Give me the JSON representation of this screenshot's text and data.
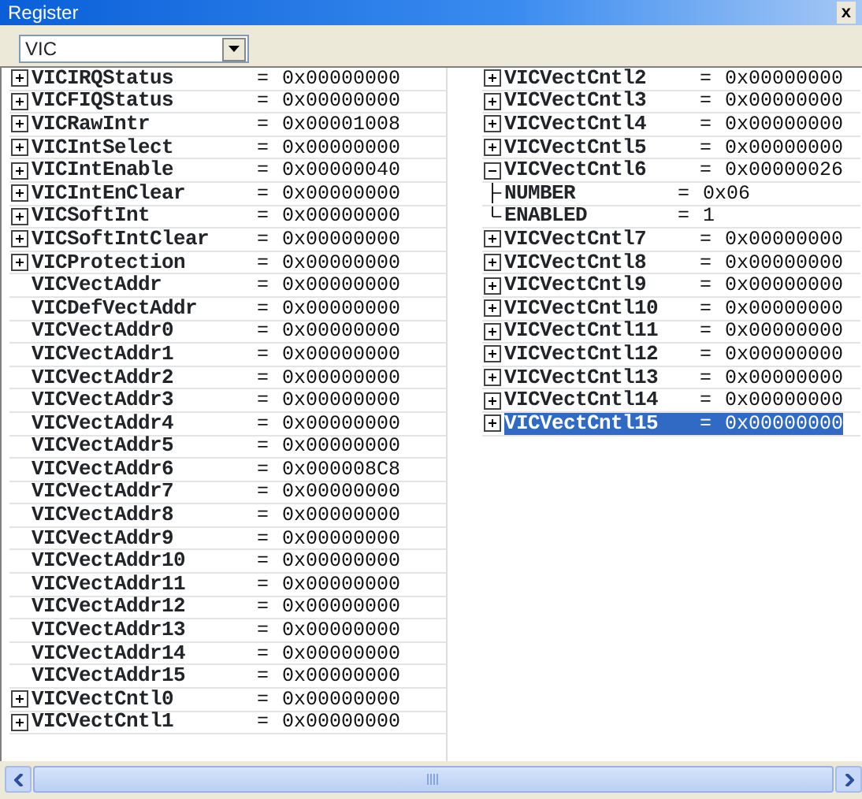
{
  "window": {
    "title": "Register",
    "close": "x"
  },
  "module_select": {
    "value": "VIC"
  },
  "columns": [
    {
      "rows": [
        {
          "name": "VICIRQStatus",
          "sep": "=",
          "value": "0x00000000",
          "kind": "expandable",
          "expanded": false,
          "selected": false
        },
        {
          "name": "VICFIQStatus",
          "sep": "=",
          "value": "0x00000000",
          "kind": "expandable",
          "expanded": false,
          "selected": false
        },
        {
          "name": "VICRawIntr",
          "sep": "=",
          "value": "0x00001008",
          "kind": "expandable",
          "expanded": false,
          "selected": false
        },
        {
          "name": "VICIntSelect",
          "sep": "=",
          "value": "0x00000000",
          "kind": "expandable",
          "expanded": false,
          "selected": false
        },
        {
          "name": "VICIntEnable",
          "sep": "=",
          "value": "0x00000040",
          "kind": "expandable",
          "expanded": false,
          "selected": false
        },
        {
          "name": "VICIntEnClear",
          "sep": "=",
          "value": "0x00000000",
          "kind": "expandable",
          "expanded": false,
          "selected": false
        },
        {
          "name": "VICSoftInt",
          "sep": "=",
          "value": "0x00000000",
          "kind": "expandable",
          "expanded": false,
          "selected": false
        },
        {
          "name": "VICSoftIntClear",
          "sep": "=",
          "value": "0x00000000",
          "kind": "expandable",
          "expanded": false,
          "selected": false
        },
        {
          "name": "VICProtection",
          "sep": "=",
          "value": "0x00000000",
          "kind": "expandable",
          "expanded": false,
          "selected": false
        },
        {
          "name": "VICVectAddr",
          "sep": "=",
          "value": "0x00000000",
          "kind": "plain",
          "selected": false
        },
        {
          "name": "VICDefVectAddr",
          "sep": "=",
          "value": "0x00000000",
          "kind": "plain",
          "selected": false
        },
        {
          "name": "VICVectAddr0",
          "sep": "=",
          "value": "0x00000000",
          "kind": "plain",
          "selected": false
        },
        {
          "name": "VICVectAddr1",
          "sep": "=",
          "value": "0x00000000",
          "kind": "plain",
          "selected": false
        },
        {
          "name": "VICVectAddr2",
          "sep": "=",
          "value": "0x00000000",
          "kind": "plain",
          "selected": false
        },
        {
          "name": "VICVectAddr3",
          "sep": "=",
          "value": "0x00000000",
          "kind": "plain",
          "selected": false
        },
        {
          "name": "VICVectAddr4",
          "sep": "=",
          "value": "0x00000000",
          "kind": "plain",
          "selected": false
        },
        {
          "name": "VICVectAddr5",
          "sep": "=",
          "value": "0x00000000",
          "kind": "plain",
          "selected": false
        },
        {
          "name": "VICVectAddr6",
          "sep": "=",
          "value": "0x000008C8",
          "kind": "plain",
          "selected": false
        },
        {
          "name": "VICVectAddr7",
          "sep": "=",
          "value": "0x00000000",
          "kind": "plain",
          "selected": false
        },
        {
          "name": "VICVectAddr8",
          "sep": "=",
          "value": "0x00000000",
          "kind": "plain",
          "selected": false
        },
        {
          "name": "VICVectAddr9",
          "sep": "=",
          "value": "0x00000000",
          "kind": "plain",
          "selected": false
        },
        {
          "name": "VICVectAddr10",
          "sep": "=",
          "value": "0x00000000",
          "kind": "plain",
          "selected": false
        },
        {
          "name": "VICVectAddr11",
          "sep": "=",
          "value": "0x00000000",
          "kind": "plain",
          "selected": false
        },
        {
          "name": "VICVectAddr12",
          "sep": "=",
          "value": "0x00000000",
          "kind": "plain",
          "selected": false
        },
        {
          "name": "VICVectAddr13",
          "sep": "=",
          "value": "0x00000000",
          "kind": "plain",
          "selected": false
        },
        {
          "name": "VICVectAddr14",
          "sep": "=",
          "value": "0x00000000",
          "kind": "plain",
          "selected": false
        },
        {
          "name": "VICVectAddr15",
          "sep": "=",
          "value": "0x00000000",
          "kind": "plain",
          "selected": false
        },
        {
          "name": "VICVectCntl0",
          "sep": "=",
          "value": "0x00000000",
          "kind": "expandable",
          "expanded": false,
          "selected": false
        },
        {
          "name": "VICVectCntl1",
          "sep": "=",
          "value": "0x00000000",
          "kind": "expandable",
          "expanded": false,
          "selected": false
        }
      ]
    },
    {
      "rows": [
        {
          "name": "VICVectCntl2",
          "sep": "=",
          "value": "0x00000000",
          "kind": "expandable",
          "expanded": false,
          "selected": false
        },
        {
          "name": "VICVectCntl3",
          "sep": "=",
          "value": "0x00000000",
          "kind": "expandable",
          "expanded": false,
          "selected": false
        },
        {
          "name": "VICVectCntl4",
          "sep": "=",
          "value": "0x00000000",
          "kind": "expandable",
          "expanded": false,
          "selected": false
        },
        {
          "name": "VICVectCntl5",
          "sep": "=",
          "value": "0x00000000",
          "kind": "expandable",
          "expanded": false,
          "selected": false
        },
        {
          "name": "VICVectCntl6",
          "sep": "=",
          "value": "0x00000026",
          "kind": "expandable",
          "expanded": true,
          "selected": false,
          "children": [
            {
              "name": "NUMBER",
              "sep": "=",
              "value": "0x06",
              "kind": "field",
              "selected": false
            },
            {
              "name": "ENABLED",
              "sep": "=",
              "value": "1",
              "kind": "field",
              "selected": false
            }
          ]
        },
        {
          "name": "VICVectCntl7",
          "sep": "=",
          "value": "0x00000000",
          "kind": "expandable",
          "expanded": false,
          "selected": false
        },
        {
          "name": "VICVectCntl8",
          "sep": "=",
          "value": "0x00000000",
          "kind": "expandable",
          "expanded": false,
          "selected": false
        },
        {
          "name": "VICVectCntl9",
          "sep": "=",
          "value": "0x00000000",
          "kind": "expandable",
          "expanded": false,
          "selected": false
        },
        {
          "name": "VICVectCntl10",
          "sep": "=",
          "value": "0x00000000",
          "kind": "expandable",
          "expanded": false,
          "selected": false
        },
        {
          "name": "VICVectCntl11",
          "sep": "=",
          "value": "0x00000000",
          "kind": "expandable",
          "expanded": false,
          "selected": false
        },
        {
          "name": "VICVectCntl12",
          "sep": "=",
          "value": "0x00000000",
          "kind": "expandable",
          "expanded": false,
          "selected": false
        },
        {
          "name": "VICVectCntl13",
          "sep": "=",
          "value": "0x00000000",
          "kind": "expandable",
          "expanded": false,
          "selected": false
        },
        {
          "name": "VICVectCntl14",
          "sep": "=",
          "value": "0x00000000",
          "kind": "expandable",
          "expanded": false,
          "selected": false
        },
        {
          "name": "VICVectCntl15",
          "sep": "=",
          "value": "0x00000000",
          "kind": "expandable",
          "expanded": false,
          "selected": true
        }
      ]
    }
  ]
}
